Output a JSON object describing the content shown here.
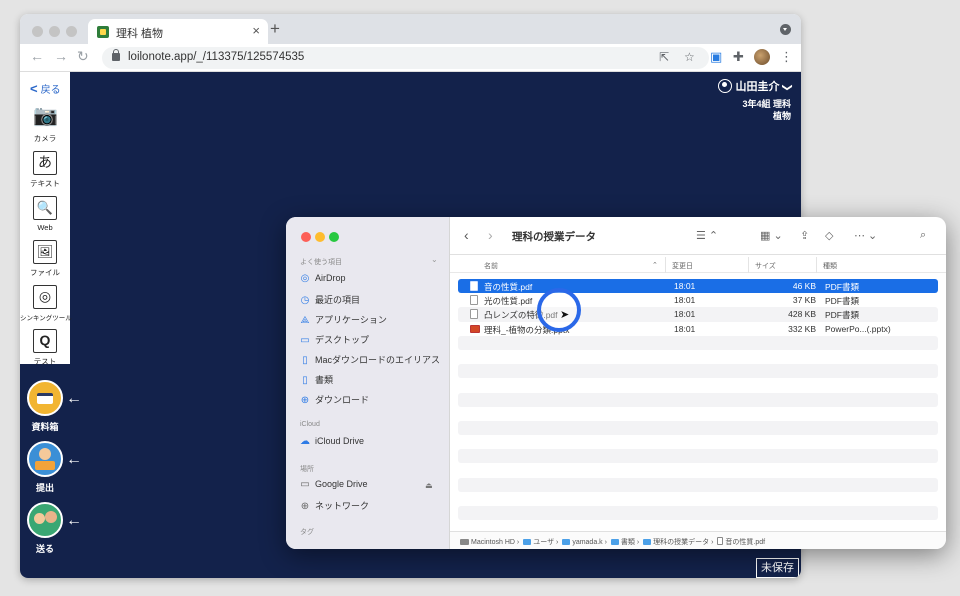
{
  "browser": {
    "tab_title": "理科 植物",
    "tab_close": "×",
    "new_tab": "+",
    "url": "loilonote.app/_/113375/125574535"
  },
  "sidebar": {
    "back_label": "戻る",
    "tools": [
      {
        "label": "カメラ",
        "icon": "camera-icon",
        "glyph": "📷"
      },
      {
        "label": "テキスト",
        "icon": "text-icon",
        "glyph": "あ"
      },
      {
        "label": "Web",
        "icon": "web-search-icon",
        "glyph": "🔍"
      },
      {
        "label": "ファイル",
        "icon": "file-image-icon",
        "glyph": "🖼"
      },
      {
        "label": "シンキングツール",
        "icon": "thinking-tool-icon",
        "glyph": "◎"
      },
      {
        "label": "テスト",
        "icon": "test-icon",
        "glyph": "Q"
      }
    ]
  },
  "left_buttons": [
    {
      "label": "資料箱",
      "icon": "material-box-icon",
      "color": "#f2b531"
    },
    {
      "label": "提出",
      "icon": "submit-icon",
      "color": "#3b8fd6"
    },
    {
      "label": "送る",
      "icon": "send-icon",
      "color": "#3aa773"
    }
  ],
  "user": {
    "name": "山田圭介",
    "class": "3年4組 理科",
    "unit": "植物",
    "chevron": "❯"
  },
  "unsaved_label": "未保存",
  "finder": {
    "title": "理科の授業データ",
    "sidebar": {
      "favorites_header": "よく使う項目",
      "icloud_header": "iCloud",
      "locations_header": "場所",
      "tags_header": "タグ",
      "favorites": [
        "AirDrop",
        "最近の項目",
        "アプリケーション",
        "デスクトップ",
        "Macダウンロードのエイリアス",
        "書類",
        "ダウンロード"
      ],
      "icloud": [
        "iCloud Drive"
      ],
      "locations": [
        "Google Drive",
        "ネットワーク"
      ]
    },
    "columns": {
      "name": "名前",
      "modified": "変更日",
      "size": "サイズ",
      "kind": "種類"
    },
    "files": [
      {
        "name": "音の性質.pdf",
        "modified": "18:01",
        "size": "46 KB",
        "kind": "PDF書類",
        "selected": true
      },
      {
        "name": "光の性質.pdf",
        "modified": "18:01",
        "size": "37 KB",
        "kind": "PDF書類",
        "selected": false
      },
      {
        "name": "凸レンズの特徴.pdf",
        "modified": "18:01",
        "size": "428 KB",
        "kind": "PDF書類",
        "selected": false
      },
      {
        "name": "理科_-植物の分類.pptx",
        "modified": "18:01",
        "size": "332 KB",
        "kind": "PowerPo...(.pptx)",
        "selected": false
      }
    ],
    "path": [
      "Macintosh HD",
      "ユーザ",
      "yamada.k",
      "書類",
      "理科の授業データ",
      "音の性質.pdf"
    ]
  },
  "colors": {
    "canvas_bg": "#13224b",
    "selection": "#1a6ee6",
    "accent": "#2a67c9"
  }
}
